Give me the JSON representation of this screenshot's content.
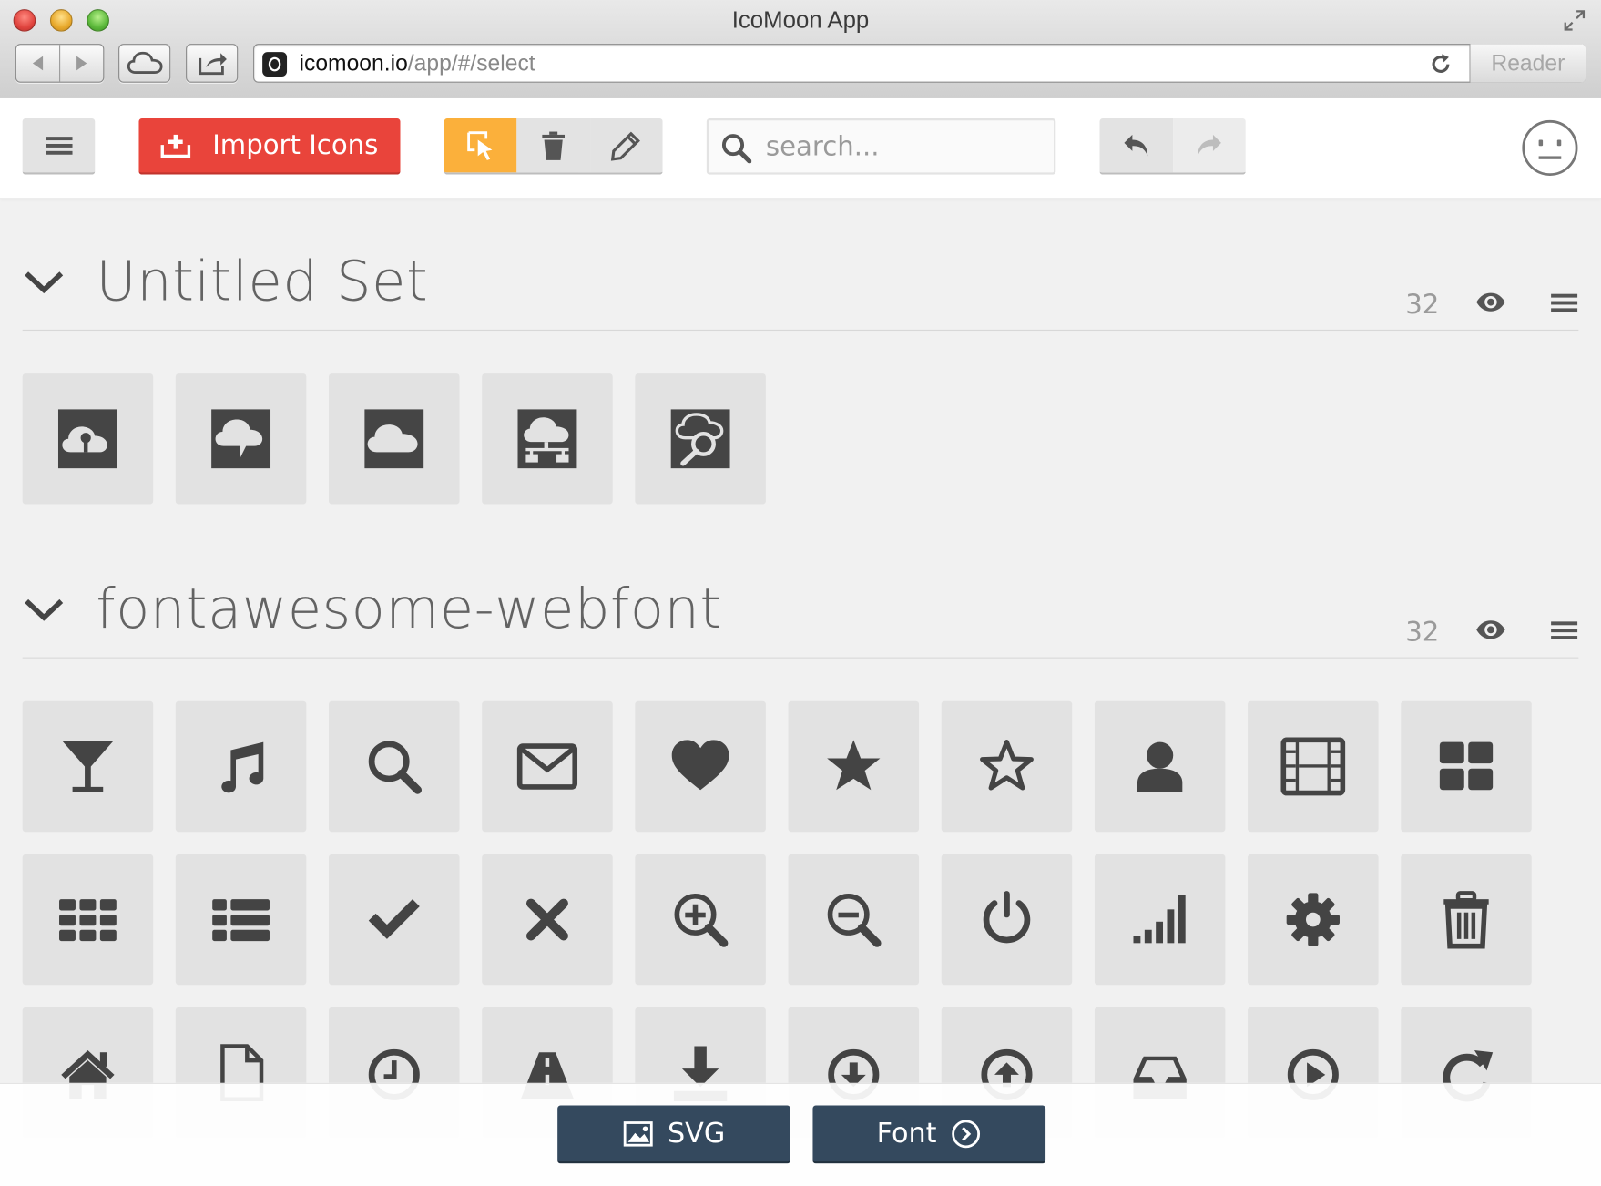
{
  "window": {
    "title": "IcoMoon App",
    "url_host": "icomoon.io",
    "url_path": "/app/#/select",
    "reader_label": "Reader"
  },
  "toolbar": {
    "import_label": "Import Icons",
    "search_placeholder": "search...",
    "accent_color": "#fbb03b",
    "import_color": "#e9443b"
  },
  "sets": [
    {
      "title": "Untitled Set",
      "count": "32",
      "icons": [
        "cloud-upload-icon",
        "cloud-chat-icon",
        "cloud-icon",
        "cloud-network-icon",
        "cloud-search-icon"
      ]
    },
    {
      "title": "fontawesome-webfont",
      "count": "32",
      "icons": [
        "glass-icon",
        "music-icon",
        "search-icon",
        "envelope-icon",
        "heart-icon",
        "star-icon",
        "star-empty-icon",
        "user-icon",
        "film-icon",
        "th-large-icon",
        "th-icon",
        "th-list-icon",
        "ok-icon",
        "remove-icon",
        "zoom-in-icon",
        "zoom-out-icon",
        "off-icon",
        "signal-icon",
        "cog-icon",
        "trash-icon",
        "home-icon",
        "file-icon",
        "time-icon",
        "road-icon",
        "download-alt-icon",
        "download-icon",
        "upload-icon",
        "inbox-icon",
        "play-circle-icon",
        "repeat-icon"
      ]
    }
  ],
  "bottom": {
    "svg_label": "SVG",
    "font_label": "Font",
    "bar_color": "#34495e"
  }
}
